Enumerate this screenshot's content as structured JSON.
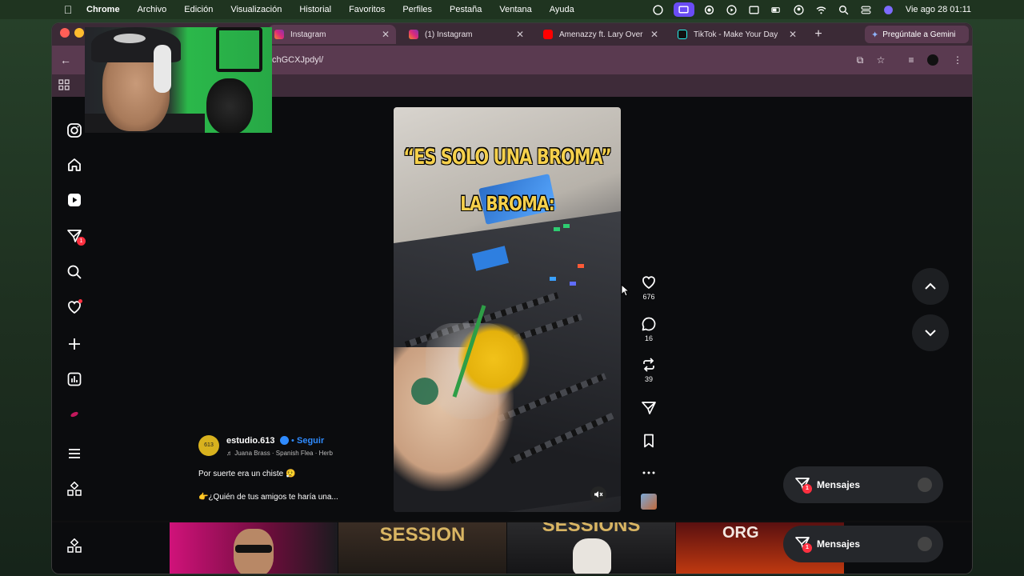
{
  "menubar": {
    "items": [
      "Chrome",
      "Archivo",
      "Edición",
      "Visualización",
      "Historial",
      "Favoritos",
      "Perfiles",
      "Pestaña",
      "Ventana",
      "Ayuda"
    ],
    "clock": "Vie ago 28  01:11"
  },
  "tabs": [
    {
      "title": "Instagram",
      "active": true
    },
    {
      "title": "(1) Instagram",
      "active": false
    },
    {
      "title": "Amenazzy ft. Lary Over",
      "active": false
    },
    {
      "title": "TikTok - Make Your Day",
      "active": false
    }
  ],
  "gemini": {
    "label": "Pregúntale a Gemini"
  },
  "toolbar": {
    "url": "chGCXJpdyl/"
  },
  "post": {
    "caption_top": "“ES SOLO UNA BROMA”",
    "caption_mid": "LA BROMA:",
    "likes": "676",
    "comments": "16",
    "reposts": "39",
    "author": "estudio.613",
    "follow": "Seguir",
    "audio": "♬ Juana Brass · Spanish Flea · Herb",
    "text1": "Por suerte era un chiste 😮‍💨",
    "text2": "👉¿Quién de tus amigos te haría una...",
    "avatar_text": "613"
  },
  "messages": {
    "label": "Mensajes",
    "badge": "1"
  },
  "sidebar": {
    "badge": "1"
  },
  "bottom": {
    "thumb2": "SESSION",
    "thumb3": "SESSIONS",
    "thumb4": "ORG"
  }
}
